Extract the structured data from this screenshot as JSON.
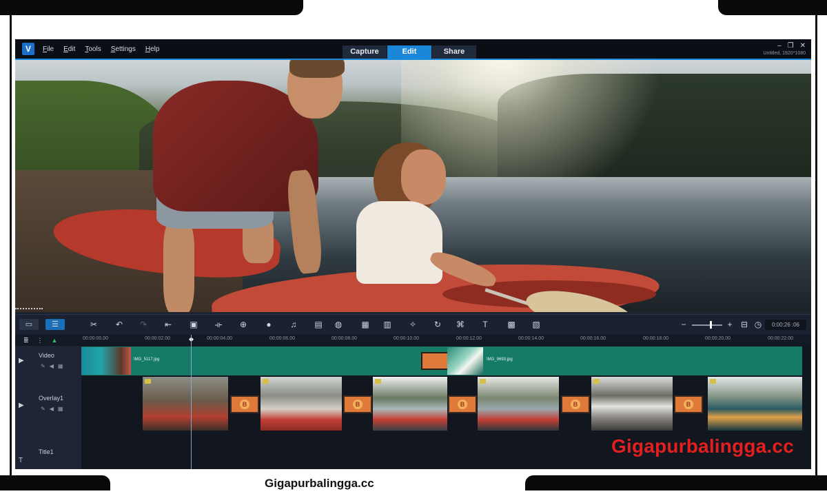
{
  "menu": {
    "logo": "V",
    "items": [
      "File",
      "Edit",
      "Tools",
      "Settings",
      "Help"
    ]
  },
  "tabs": {
    "capture": "Capture",
    "edit": "Edit",
    "share": "Share",
    "active": "Edit"
  },
  "window": {
    "minimize": "–",
    "restore": "❐",
    "close": "✕",
    "project_info": "Untitled, 1920*1080"
  },
  "toolbar": {
    "timecode": "0:00:26 :06",
    "zoom_level": 0.6
  },
  "ruler": {
    "ticks": [
      "00:00:00.00",
      "00:00:02.00",
      "00:00:04.00",
      "00:00:06.00",
      "00:00:08.00",
      "00:00:10.00",
      "00:00:12.00",
      "00:00:14.00",
      "00:00:16.00",
      "00:00:18.00",
      "00:00:20.00",
      "00:00:22.00"
    ]
  },
  "tracks": {
    "video": {
      "label": "Video",
      "clips": [
        "IMG_5117.jpg",
        "IMG_9693.jpg"
      ]
    },
    "overlay": {
      "label": "Overlay1",
      "transition_glyph": "B"
    },
    "title": {
      "label": "Title1"
    }
  },
  "watermark": "Gigapurbalingga.cc",
  "caption": "Gigapurbalingga.cc",
  "colors": {
    "accent": "#1b87d8",
    "video_track": "#157a66",
    "watermark": "#e41f1f",
    "transition": "#e07a3a"
  }
}
